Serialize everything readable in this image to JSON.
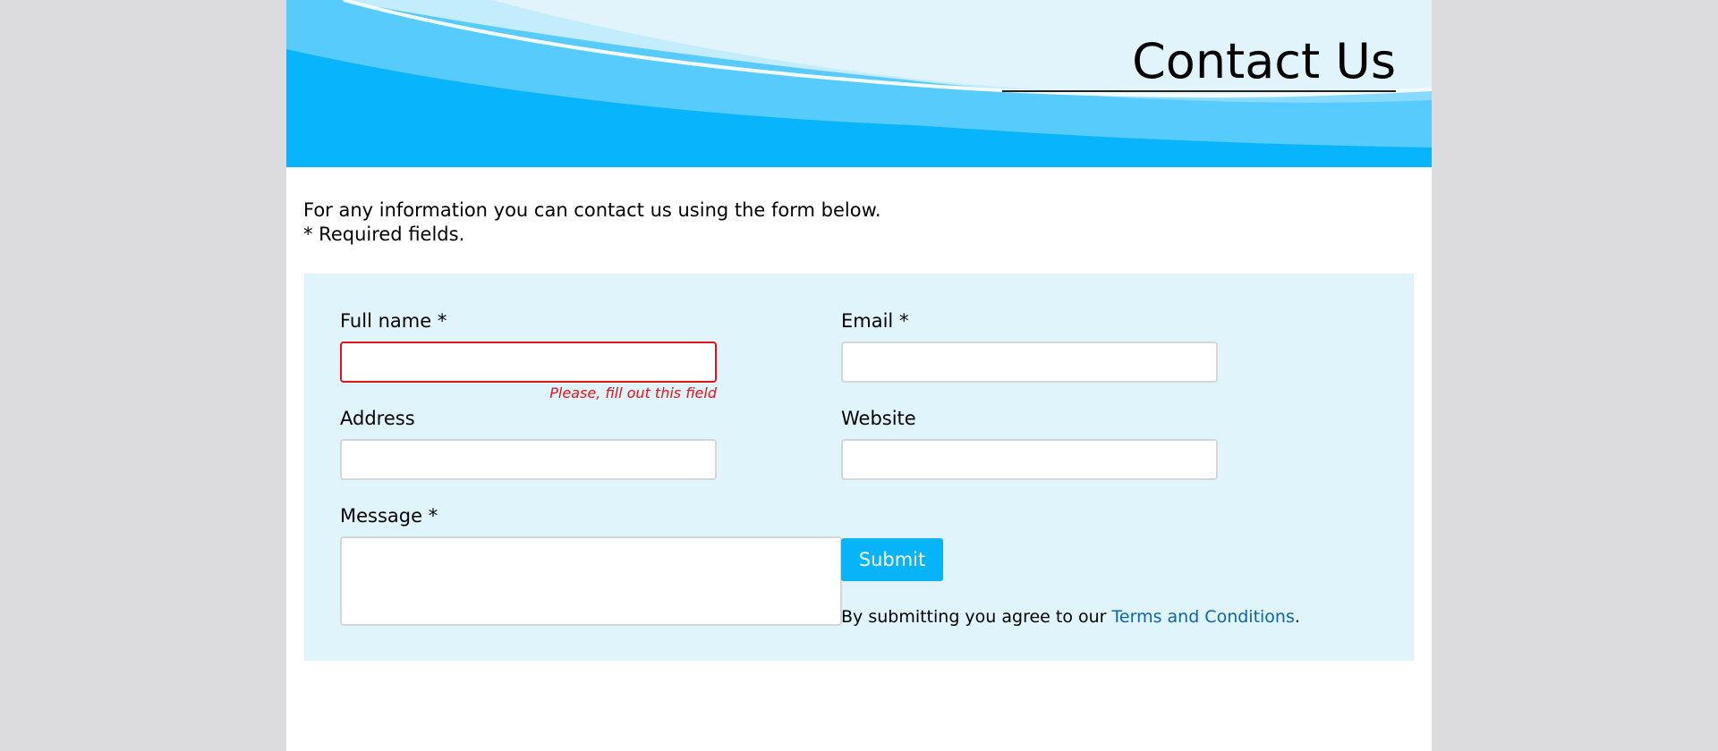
{
  "header": {
    "title": "Contact Us"
  },
  "intro": {
    "line1": "For any information you can contact us using the form below.",
    "line2": "* Required fields."
  },
  "form": {
    "full_name": {
      "label": "Full name *",
      "value": "",
      "error": "Please, fill out this field"
    },
    "email": {
      "label": "Email *",
      "value": ""
    },
    "address": {
      "label": "Address",
      "value": ""
    },
    "website": {
      "label": "Website",
      "value": ""
    },
    "message": {
      "label": "Message *",
      "value": ""
    },
    "submit_label": "Submit",
    "agree_prefix": "By submitting you agree to our ",
    "terms_link": "Terms and Conditions",
    "agree_suffix": "."
  },
  "colors": {
    "page_background": "#dcdcde",
    "banner_blue": "#08b4fc",
    "form_panel": "#dff4fb",
    "error_red": "#e0141c",
    "link_blue": "#0b63b5",
    "submit_blue": "#08b4f8"
  }
}
